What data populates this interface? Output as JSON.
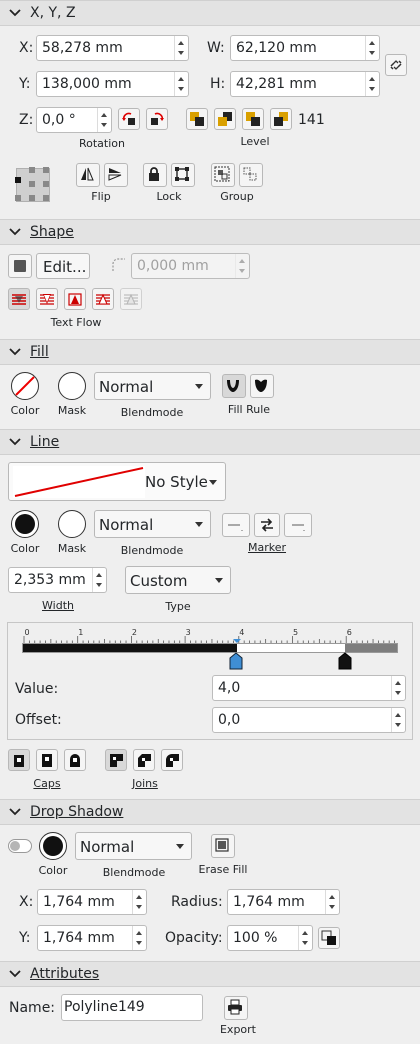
{
  "xyz": {
    "title": "X, Y, Z",
    "x_label": "X:",
    "x_value": "58,278 mm",
    "y_label": "Y:",
    "y_value": "138,000 mm",
    "w_label": "W:",
    "w_value": "62,120 mm",
    "h_label": "H:",
    "h_value": "42,281 mm",
    "z_label": "Z:",
    "z_value": "0,0 °",
    "rotation_label": "Rotation",
    "level_label": "Level",
    "level_value": "141",
    "flip_label": "Flip",
    "lock_label": "Lock",
    "group_label": "Group"
  },
  "shape": {
    "title": "Shape",
    "edit_label": "Edit...",
    "corner_value": "0,000 mm",
    "text_flow_label": "Text Flow"
  },
  "fill": {
    "title": "Fill",
    "color_label": "Color",
    "mask_label": "Mask",
    "blendmode_value": "Normal",
    "blendmode_label": "Blendmode",
    "fill_rule_label": "Fill Rule"
  },
  "line": {
    "title": "Line",
    "style_value": "No Style",
    "color_label": "Color",
    "mask_label": "Mask",
    "blendmode_value": "Normal",
    "blendmode_label": "Blendmode",
    "marker_label": "Marker",
    "width_value": "2,353 mm",
    "width_label": "Width",
    "type_value": "Custom",
    "type_label": "Type",
    "ruler_ticks": [
      "0",
      "1",
      "2",
      "3",
      "4",
      "5",
      "6"
    ],
    "value_label": "Value:",
    "value_value": "4,0",
    "offset_label": "Offset:",
    "offset_value": "0,0",
    "caps_label": "Caps",
    "joins_label": "Joins",
    "colors": {
      "line_stroke": "#e00000"
    }
  },
  "drop_shadow": {
    "title": "Drop Shadow",
    "color_label": "Color",
    "blendmode_value": "Normal",
    "blendmode_label": "Blendmode",
    "erase_fill_label": "Erase Fill",
    "x_label": "X:",
    "x_value": "1,764 mm",
    "y_label": "Y:",
    "y_value": "1,764 mm",
    "radius_label": "Radius:",
    "radius_value": "1,764 mm",
    "opacity_label": "Opacity:",
    "opacity_value": "100 %"
  },
  "attributes": {
    "title": "Attributes",
    "name_label": "Name:",
    "name_value": "Polyline149",
    "export_label": "Export"
  }
}
